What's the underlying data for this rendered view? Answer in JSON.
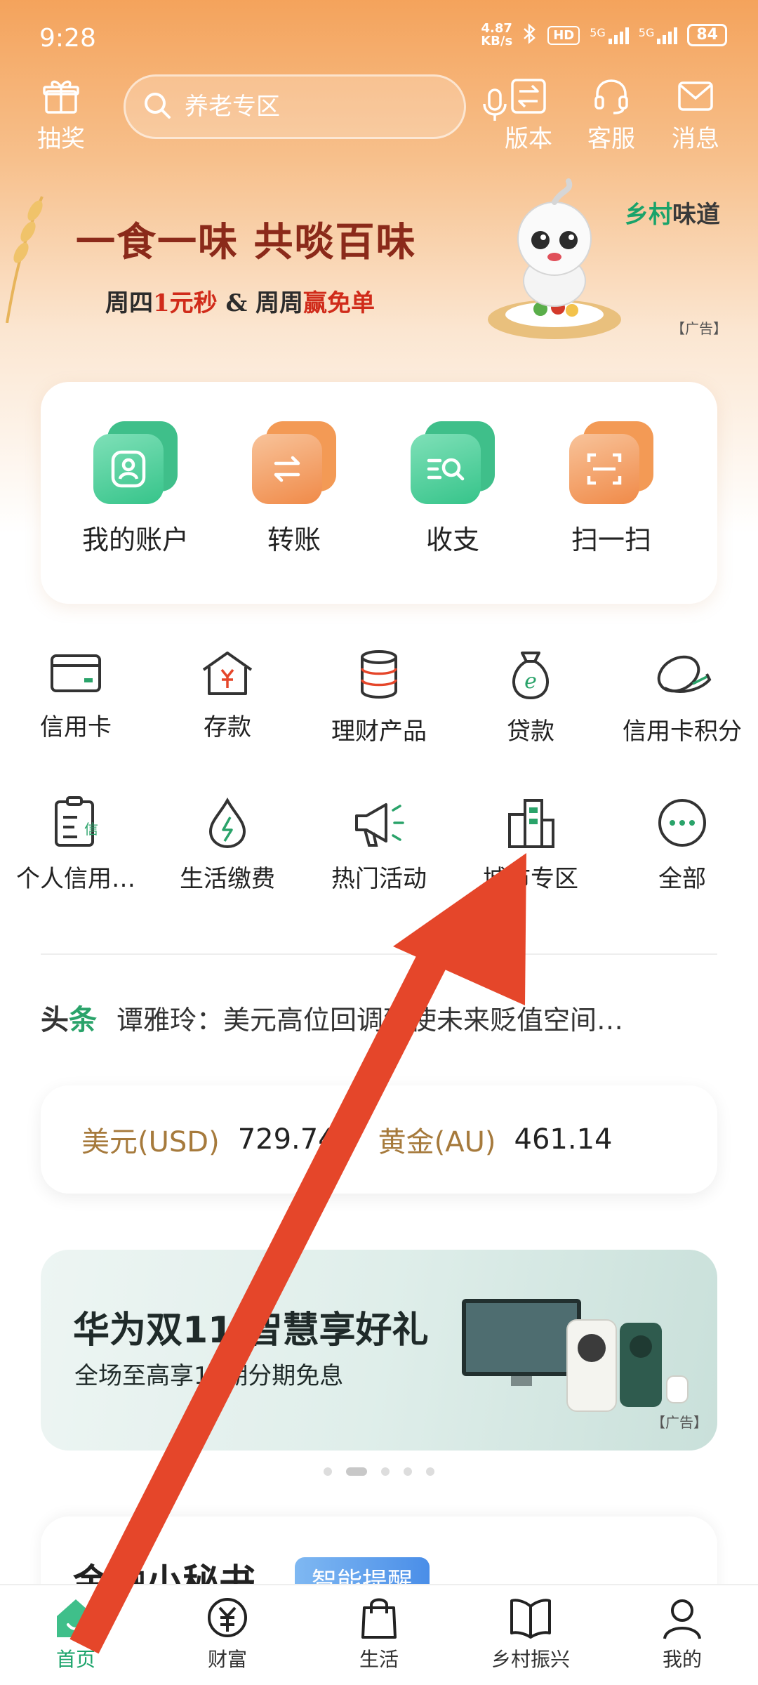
{
  "status_bar": {
    "time": "9:28",
    "net_speed_value": "4.87",
    "net_speed_unit": "KB/s",
    "hd_label": "HD",
    "net1": "5G",
    "net2": "5G",
    "battery": "84"
  },
  "header": {
    "lottery_label": "抽奖",
    "search_placeholder": "养老专区",
    "version_label": "版本",
    "service_label": "客服",
    "message_label": "消息"
  },
  "banner_top": {
    "headline": "一食一味 共啖百味",
    "sub_prefix": "周四",
    "sub_red1": "1元秒",
    "sub_mid": " & 周周",
    "sub_red2": "赢免单",
    "brand_prefix": "乡村",
    "brand_suffix": "味道",
    "ad_label": "【广告】"
  },
  "main_actions": [
    {
      "label": "我的账户"
    },
    {
      "label": "转账"
    },
    {
      "label": "收支"
    },
    {
      "label": "扫一扫"
    }
  ],
  "grid_row1": [
    {
      "label": "信用卡"
    },
    {
      "label": "存款"
    },
    {
      "label": "理财产品"
    },
    {
      "label": "贷款"
    },
    {
      "label": "信用卡积分"
    }
  ],
  "grid_row2": [
    {
      "label": "个人信用…"
    },
    {
      "label": "生活缴费"
    },
    {
      "label": "热门活动"
    },
    {
      "label": "城市专区"
    },
    {
      "label": "全部"
    }
  ],
  "news": {
    "tag_a": "头",
    "tag_b": "条",
    "text": "谭雅玲：美元高位回调致使未来贬值空间…"
  },
  "rates": [
    {
      "name": "美元(USD)",
      "value": "729.74"
    },
    {
      "name": "黄金(AU)",
      "value": "461.14"
    }
  ],
  "banner2": {
    "title": "华为双11 智慧享好礼",
    "subtitle": "全场至高享12期分期免息",
    "ad_label": "【广告】"
  },
  "carousel": {
    "count": 5,
    "active": 1
  },
  "next_card": {
    "title": "金融小秘书",
    "badge": "智能提醒"
  },
  "tabs": [
    {
      "label": "首页"
    },
    {
      "label": "财富"
    },
    {
      "label": "生活"
    },
    {
      "label": "乡村振兴"
    },
    {
      "label": "我的"
    }
  ],
  "colors": {
    "accent_green": "#1aa36a",
    "header_orange": "#f4a35c",
    "rate_gold": "#a67a3c",
    "annotation_red": "#e5462a"
  }
}
